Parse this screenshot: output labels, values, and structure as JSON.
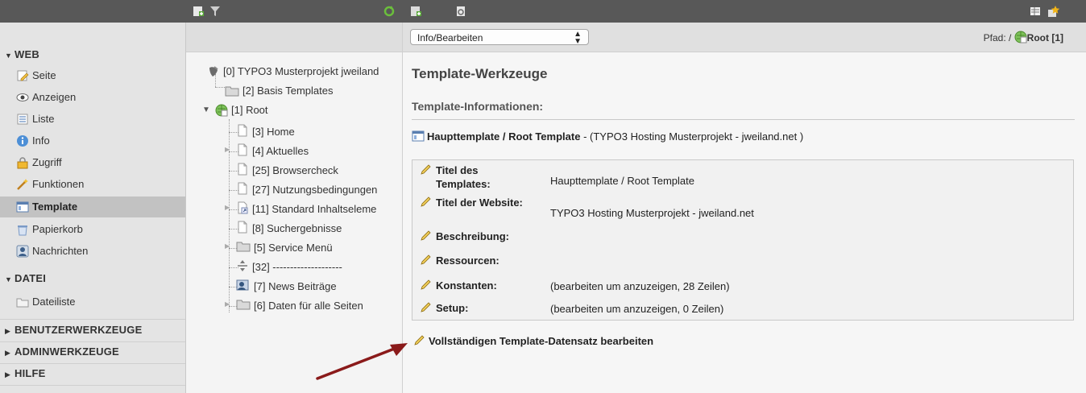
{
  "modules": {
    "web": {
      "label": "WEB",
      "items": [
        {
          "label": "Seite",
          "icon": "page-edit-icon"
        },
        {
          "label": "Anzeigen",
          "icon": "eye-icon"
        },
        {
          "label": "Liste",
          "icon": "list-icon"
        },
        {
          "label": "Info",
          "icon": "info-icon"
        },
        {
          "label": "Zugriff",
          "icon": "lock-icon"
        },
        {
          "label": "Funktionen",
          "icon": "wand-icon"
        },
        {
          "label": "Template",
          "icon": "template-icon",
          "active": true
        },
        {
          "label": "Papierkorb",
          "icon": "trash-icon"
        },
        {
          "label": "Nachrichten",
          "icon": "messages-icon"
        }
      ]
    },
    "datei": {
      "label": "DATEI",
      "items": [
        {
          "label": "Dateiliste",
          "icon": "folder-icon"
        }
      ]
    },
    "benutzer": {
      "label": "BENUTZERWERKZEUGE"
    },
    "admin": {
      "label": "ADMINWERKZEUGE"
    },
    "hilfe": {
      "label": "HILFE"
    }
  },
  "tree": {
    "root": "[0] TYPO3 Musterprojekt jweiland",
    "basis": "[2] Basis Templates",
    "rootpage": "[1] Root",
    "children": [
      "[3] Home",
      "[4] Aktuelles",
      "[25] Browsercheck",
      "[27] Nutzungsbedingungen",
      "[11] Standard Inhaltseleme",
      "[8] Suchergebnisse",
      "[5] Service Menü",
      "[32] --------------------",
      "[7] News Beiträge",
      "[6] Daten für alle Seiten"
    ]
  },
  "docheader": {
    "select_value": "Info/Bearbeiten",
    "path_label": "Pfad: /",
    "path_root": "Root [1]"
  },
  "content": {
    "title": "Template-Werkzeuge",
    "subtitle": "Template-Informationen:",
    "template_name": "Haupttemplate / Root Template",
    "template_suffix": " - (TYPO3 Hosting Musterprojekt - jweiland.net )",
    "rows": [
      {
        "key": "Titel des Templates:",
        "value": "Haupttemplate / Root Template"
      },
      {
        "key": "Titel der Website:",
        "value": "TYPO3 Hosting Musterprojekt - jweiland.net"
      },
      {
        "key": "Beschreibung:",
        "value": ""
      },
      {
        "key": "Ressourcen:",
        "value": ""
      },
      {
        "key": "Konstanten:",
        "value": "(bearbeiten um anzuzeigen, 28 Zeilen)"
      },
      {
        "key": "Setup:",
        "value": "(bearbeiten um anzuzeigen, 0 Zeilen)"
      }
    ],
    "full_edit": "Vollständigen Template-Datensatz bearbeiten"
  },
  "colors": {
    "topbar": "#585858",
    "menu_bg": "#e4e4e4",
    "active_item": "#c2c2c2",
    "arrow": "#8a1a1a"
  }
}
